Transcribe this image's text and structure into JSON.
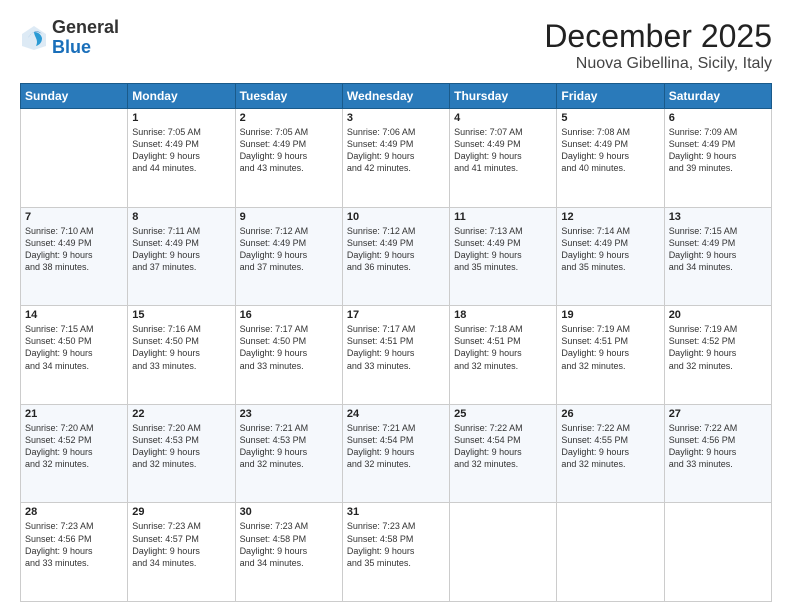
{
  "header": {
    "logo": {
      "line1": "General",
      "line2": "Blue"
    },
    "title": "December 2025",
    "location": "Nuova Gibellina, Sicily, Italy"
  },
  "calendar": {
    "headers": [
      "Sunday",
      "Monday",
      "Tuesday",
      "Wednesday",
      "Thursday",
      "Friday",
      "Saturday"
    ],
    "weeks": [
      [
        {
          "day": "",
          "info": ""
        },
        {
          "day": "1",
          "info": "Sunrise: 7:05 AM\nSunset: 4:49 PM\nDaylight: 9 hours\nand 44 minutes."
        },
        {
          "day": "2",
          "info": "Sunrise: 7:05 AM\nSunset: 4:49 PM\nDaylight: 9 hours\nand 43 minutes."
        },
        {
          "day": "3",
          "info": "Sunrise: 7:06 AM\nSunset: 4:49 PM\nDaylight: 9 hours\nand 42 minutes."
        },
        {
          "day": "4",
          "info": "Sunrise: 7:07 AM\nSunset: 4:49 PM\nDaylight: 9 hours\nand 41 minutes."
        },
        {
          "day": "5",
          "info": "Sunrise: 7:08 AM\nSunset: 4:49 PM\nDaylight: 9 hours\nand 40 minutes."
        },
        {
          "day": "6",
          "info": "Sunrise: 7:09 AM\nSunset: 4:49 PM\nDaylight: 9 hours\nand 39 minutes."
        }
      ],
      [
        {
          "day": "7",
          "info": "Sunrise: 7:10 AM\nSunset: 4:49 PM\nDaylight: 9 hours\nand 38 minutes."
        },
        {
          "day": "8",
          "info": "Sunrise: 7:11 AM\nSunset: 4:49 PM\nDaylight: 9 hours\nand 37 minutes."
        },
        {
          "day": "9",
          "info": "Sunrise: 7:12 AM\nSunset: 4:49 PM\nDaylight: 9 hours\nand 37 minutes."
        },
        {
          "day": "10",
          "info": "Sunrise: 7:12 AM\nSunset: 4:49 PM\nDaylight: 9 hours\nand 36 minutes."
        },
        {
          "day": "11",
          "info": "Sunrise: 7:13 AM\nSunset: 4:49 PM\nDaylight: 9 hours\nand 35 minutes."
        },
        {
          "day": "12",
          "info": "Sunrise: 7:14 AM\nSunset: 4:49 PM\nDaylight: 9 hours\nand 35 minutes."
        },
        {
          "day": "13",
          "info": "Sunrise: 7:15 AM\nSunset: 4:49 PM\nDaylight: 9 hours\nand 34 minutes."
        }
      ],
      [
        {
          "day": "14",
          "info": "Sunrise: 7:15 AM\nSunset: 4:50 PM\nDaylight: 9 hours\nand 34 minutes."
        },
        {
          "day": "15",
          "info": "Sunrise: 7:16 AM\nSunset: 4:50 PM\nDaylight: 9 hours\nand 33 minutes."
        },
        {
          "day": "16",
          "info": "Sunrise: 7:17 AM\nSunset: 4:50 PM\nDaylight: 9 hours\nand 33 minutes."
        },
        {
          "day": "17",
          "info": "Sunrise: 7:17 AM\nSunset: 4:51 PM\nDaylight: 9 hours\nand 33 minutes."
        },
        {
          "day": "18",
          "info": "Sunrise: 7:18 AM\nSunset: 4:51 PM\nDaylight: 9 hours\nand 32 minutes."
        },
        {
          "day": "19",
          "info": "Sunrise: 7:19 AM\nSunset: 4:51 PM\nDaylight: 9 hours\nand 32 minutes."
        },
        {
          "day": "20",
          "info": "Sunrise: 7:19 AM\nSunset: 4:52 PM\nDaylight: 9 hours\nand 32 minutes."
        }
      ],
      [
        {
          "day": "21",
          "info": "Sunrise: 7:20 AM\nSunset: 4:52 PM\nDaylight: 9 hours\nand 32 minutes."
        },
        {
          "day": "22",
          "info": "Sunrise: 7:20 AM\nSunset: 4:53 PM\nDaylight: 9 hours\nand 32 minutes."
        },
        {
          "day": "23",
          "info": "Sunrise: 7:21 AM\nSunset: 4:53 PM\nDaylight: 9 hours\nand 32 minutes."
        },
        {
          "day": "24",
          "info": "Sunrise: 7:21 AM\nSunset: 4:54 PM\nDaylight: 9 hours\nand 32 minutes."
        },
        {
          "day": "25",
          "info": "Sunrise: 7:22 AM\nSunset: 4:54 PM\nDaylight: 9 hours\nand 32 minutes."
        },
        {
          "day": "26",
          "info": "Sunrise: 7:22 AM\nSunset: 4:55 PM\nDaylight: 9 hours\nand 32 minutes."
        },
        {
          "day": "27",
          "info": "Sunrise: 7:22 AM\nSunset: 4:56 PM\nDaylight: 9 hours\nand 33 minutes."
        }
      ],
      [
        {
          "day": "28",
          "info": "Sunrise: 7:23 AM\nSunset: 4:56 PM\nDaylight: 9 hours\nand 33 minutes."
        },
        {
          "day": "29",
          "info": "Sunrise: 7:23 AM\nSunset: 4:57 PM\nDaylight: 9 hours\nand 34 minutes."
        },
        {
          "day": "30",
          "info": "Sunrise: 7:23 AM\nSunset: 4:58 PM\nDaylight: 9 hours\nand 34 minutes."
        },
        {
          "day": "31",
          "info": "Sunrise: 7:23 AM\nSunset: 4:58 PM\nDaylight: 9 hours\nand 35 minutes."
        },
        {
          "day": "",
          "info": ""
        },
        {
          "day": "",
          "info": ""
        },
        {
          "day": "",
          "info": ""
        }
      ]
    ]
  }
}
